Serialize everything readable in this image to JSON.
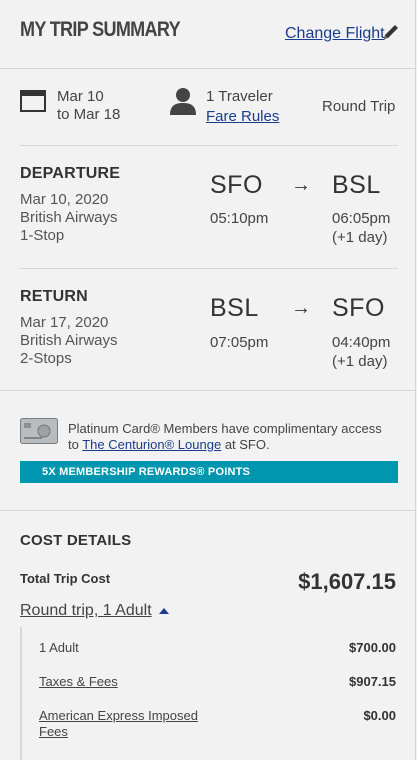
{
  "header": {
    "title": "MY TRIP SUMMARY",
    "change_flight_label": "Change Flight"
  },
  "summary": {
    "date_from": "Mar 10",
    "date_to": "to Mar 18",
    "travelers": "1 Traveler",
    "fare_rules_label": "Fare Rules",
    "trip_type": "Round Trip"
  },
  "departure": {
    "heading": "DEPARTURE",
    "date": "Mar 10, 2020",
    "airline": "British Airways",
    "stops": "1-Stop",
    "origin": "SFO",
    "destination": "BSL",
    "depart_time": "05:10pm",
    "arrive_time": "06:05pm",
    "day_offset": "(+1 day)",
    "arrow": "→"
  },
  "return": {
    "heading": "RETURN",
    "date": "Mar 17, 2020",
    "airline": "British Airways",
    "stops": "2-Stops",
    "origin": "BSL",
    "destination": "SFO",
    "depart_time": "07:05pm",
    "arrive_time": "04:40pm",
    "day_offset": "(+1 day)",
    "arrow": "→"
  },
  "lounge": {
    "text_line1": "Platinum Card® Members have complimentary access",
    "text_to": "to",
    "lounge_link": "The Centurion® Lounge",
    "text_at": "at SFO.",
    "banner": "5X MEMBERSHIP REWARDS® POINTS"
  },
  "cost": {
    "heading": "COST DETAILS",
    "total_label": "Total Trip Cost",
    "total_value": "$1,607.15",
    "breakdown_toggle": "Round trip, 1 Adult",
    "rows": [
      {
        "label": "1 Adult",
        "value": "$700.00"
      },
      {
        "label": "Taxes & Fees",
        "value": "$907.15"
      },
      {
        "label_line1": "American Express Imposed",
        "label_line2": "Fees",
        "value": "$0.00"
      }
    ]
  },
  "colors": {
    "banner": "#0096b0",
    "link": "#1a3c8c",
    "background": "#f2f2f2"
  }
}
